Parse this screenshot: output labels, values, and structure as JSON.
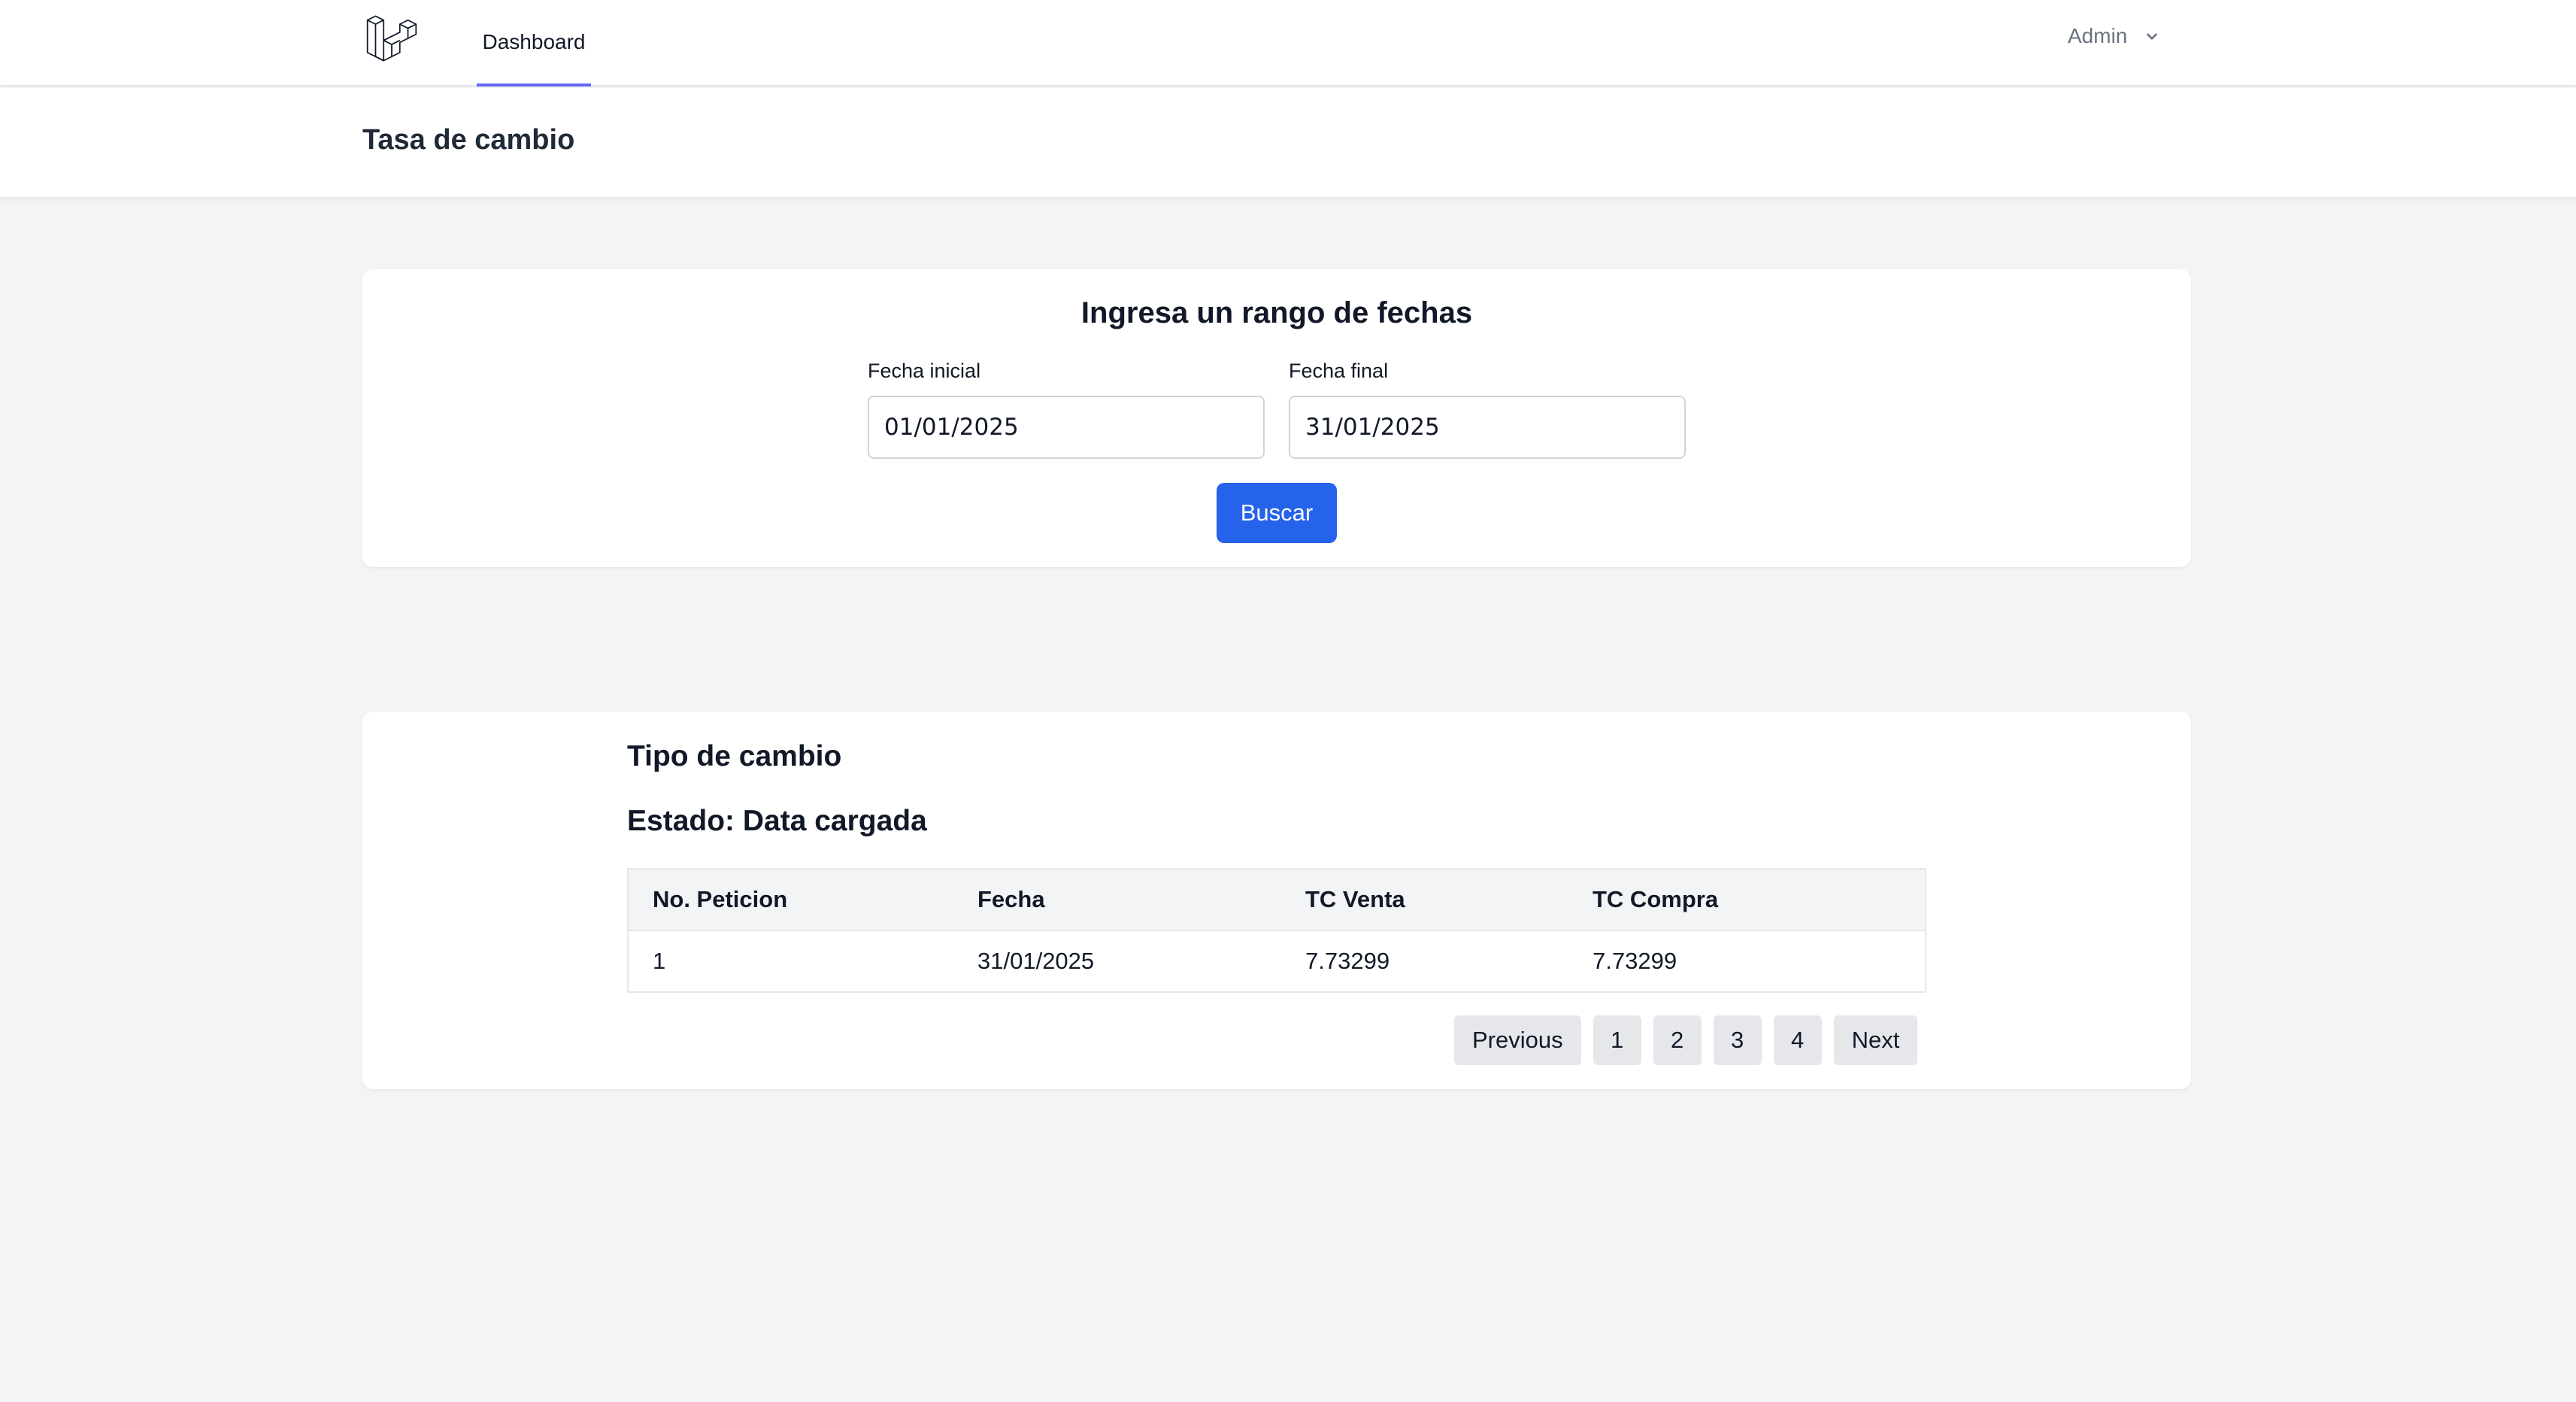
{
  "nav": {
    "logo_icon": "laravel-logo-icon",
    "links": [
      {
        "label": "Dashboard",
        "active": true
      }
    ],
    "user": {
      "label": "Admin",
      "icon": "chevron-down-icon"
    }
  },
  "header": {
    "title": "Tasa de cambio"
  },
  "search_form": {
    "title": "Ingresa un rango de fechas",
    "start": {
      "label": "Fecha inicial",
      "value": "01/01/2025"
    },
    "end": {
      "label": "Fecha final",
      "value": "31/01/2025"
    },
    "submit_label": "Buscar"
  },
  "results": {
    "title": "Tipo de cambio",
    "status": "Estado: Data cargada",
    "columns": [
      "No. Peticion",
      "Fecha",
      "TC Venta",
      "TC Compra"
    ],
    "rows": [
      [
        "1",
        "31/01/2025",
        "7.73299",
        "7.73299"
      ]
    ],
    "pagination": {
      "previous_label": "Previous",
      "pages": [
        "1",
        "2",
        "3",
        "4"
      ],
      "next_label": "Next"
    }
  },
  "colors": {
    "accent": "#6366f1",
    "primary_button": "#2563eb",
    "background": "#f3f4f6"
  }
}
